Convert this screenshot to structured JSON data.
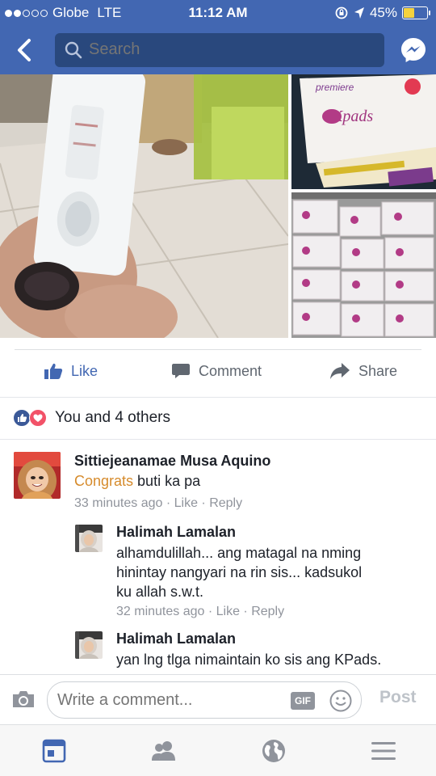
{
  "status_bar": {
    "carrier": "Globe",
    "network": "LTE",
    "time": "11:12 AM",
    "battery_text": "45%",
    "battery_level": 0.45,
    "signal_bars_on": 2
  },
  "nav": {
    "search_placeholder": "Search"
  },
  "actions": {
    "like_label": "Like",
    "comment_label": "Comment",
    "share_label": "Share"
  },
  "reactions": {
    "summary": "You and 4 others"
  },
  "comments": [
    {
      "author": "Sittiejeanamae Musa Aquino",
      "highlight": "Congrats",
      "text": " buti ka pa",
      "time": "33 minutes ago",
      "like": "Like",
      "reply": "Reply"
    }
  ],
  "replies": [
    {
      "author": "Halimah Lamalan",
      "text_lines": [
        "alhamdulillah... ang matagal na nming",
        "hinintay nangyari na rin sis... kadsukol",
        "ku allah s.w.t."
      ],
      "time": "32 minutes ago",
      "like": "Like",
      "reply": "Reply"
    },
    {
      "author": "Halimah Lamalan",
      "text_lines": [
        "yan lng tlga nimaintain ko sis ang KPads."
      ]
    }
  ],
  "photo_text": {
    "brand_line": "premiere",
    "product_name": "Kpads"
  },
  "composer": {
    "placeholder": "Write a comment...",
    "gif_label": "GIF",
    "post_label": "Post"
  },
  "colors": {
    "facebook_blue": "#4267b2",
    "search_bg": "#29487d",
    "like_blue": "#4267b2",
    "highlight_orange": "#d68b2c",
    "meta_gray": "#90949c"
  },
  "icons": {
    "back": "chevron-left-icon",
    "search": "search-icon",
    "messenger": "messenger-icon",
    "like": "thumbs-up-icon",
    "comment": "speech-bubble-icon",
    "share": "share-arrow-icon",
    "camera": "camera-icon",
    "emoji": "smiley-icon",
    "tabs": [
      "news-feed-icon",
      "friends-icon",
      "globe-icon",
      "menu-icon"
    ]
  }
}
